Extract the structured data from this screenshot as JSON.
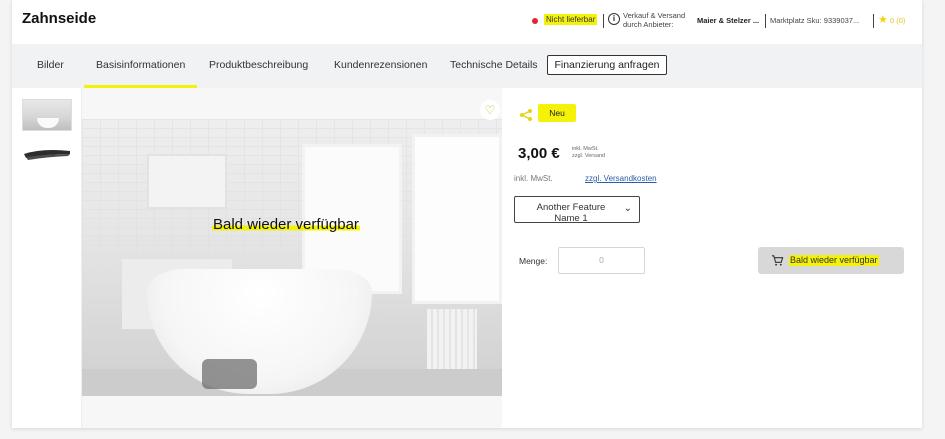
{
  "header": {
    "title": "Zahnseide",
    "availability": "Nicht lieferbar",
    "shipping_line1": "Verkauf & Versand",
    "shipping_line2": "durch Anbieter:",
    "seller": "Maier & Stelzer ...",
    "sku": "Marktplatz Sku: 9339037...",
    "rating": "0 (0)",
    "colors": {
      "status_red": "#e3262f",
      "accent_yellow": "#f5f20a"
    }
  },
  "tabs": [
    {
      "label": "Bilder"
    },
    {
      "label": "Basisinformationen",
      "active": true
    },
    {
      "label": "Produktbeschreibung"
    },
    {
      "label": "Kundenrezensionen"
    },
    {
      "label": "Technische Details"
    }
  ],
  "financing_button": "Finanzierung anfragen",
  "image": {
    "overlay": "Bald wieder verfügbar",
    "icons": [
      "heart-icon"
    ]
  },
  "details": {
    "badge": "Neu",
    "price": "3,00 €",
    "price_note_1": "inkl. MwSt.",
    "price_note_2": "zzgl. Versand",
    "vat": "inkl. MwSt.",
    "shipping_link": "zzgl. Versandkosten",
    "feature_select": "Another Feature Name 1",
    "qty_label": "Menge:",
    "qty_value": "0",
    "cart_button": "Bald wieder verfügbar"
  }
}
